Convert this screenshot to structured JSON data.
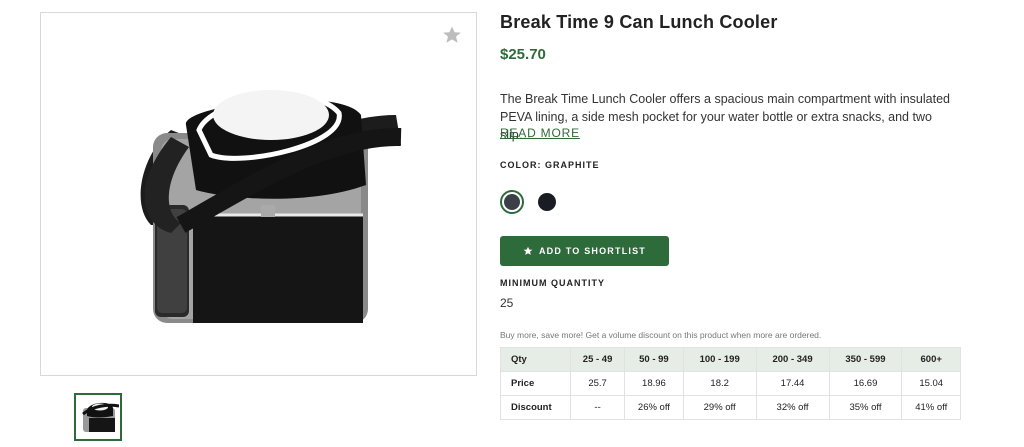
{
  "product": {
    "title": "Break Time 9 Can Lunch Cooler",
    "price": "$25.70",
    "description": "The Break Time Lunch Cooler offers a spacious main compartment with insulated PEVA lining, a side mesh pocket for your water bottle or extra snacks, and two slip…",
    "read_more": "READ MORE",
    "color_label": "COLOR: GRAPHITE",
    "colors": [
      {
        "name": "Graphite",
        "hex": "#3b3f47",
        "selected": true
      },
      {
        "name": "Black",
        "hex": "#1a1c24",
        "selected": false
      }
    ],
    "shortlist_label": "ADD TO SHORTLIST",
    "min_qty_label": "MINIMUM QUANTITY",
    "min_qty_value": "25",
    "volume_note": "Buy more, save more! Get a volume discount on this product when more are ordered."
  },
  "pricing_table": {
    "header": [
      "Qty",
      "25 - 49",
      "50 - 99",
      "100 - 199",
      "200 - 349",
      "350 - 599",
      "600+"
    ],
    "rows": [
      [
        "Price",
        "25.7",
        "18.96",
        "18.2",
        "17.44",
        "16.69",
        "15.04"
      ],
      [
        "Discount",
        "--",
        "26% off",
        "29% off",
        "32% off",
        "35% off",
        "41% off"
      ]
    ]
  },
  "icons": {
    "favorite": "star-icon",
    "shortlist": "star-icon"
  },
  "colors": {
    "accent": "#2e6b3a",
    "table_header_bg": "#e6ece6"
  }
}
